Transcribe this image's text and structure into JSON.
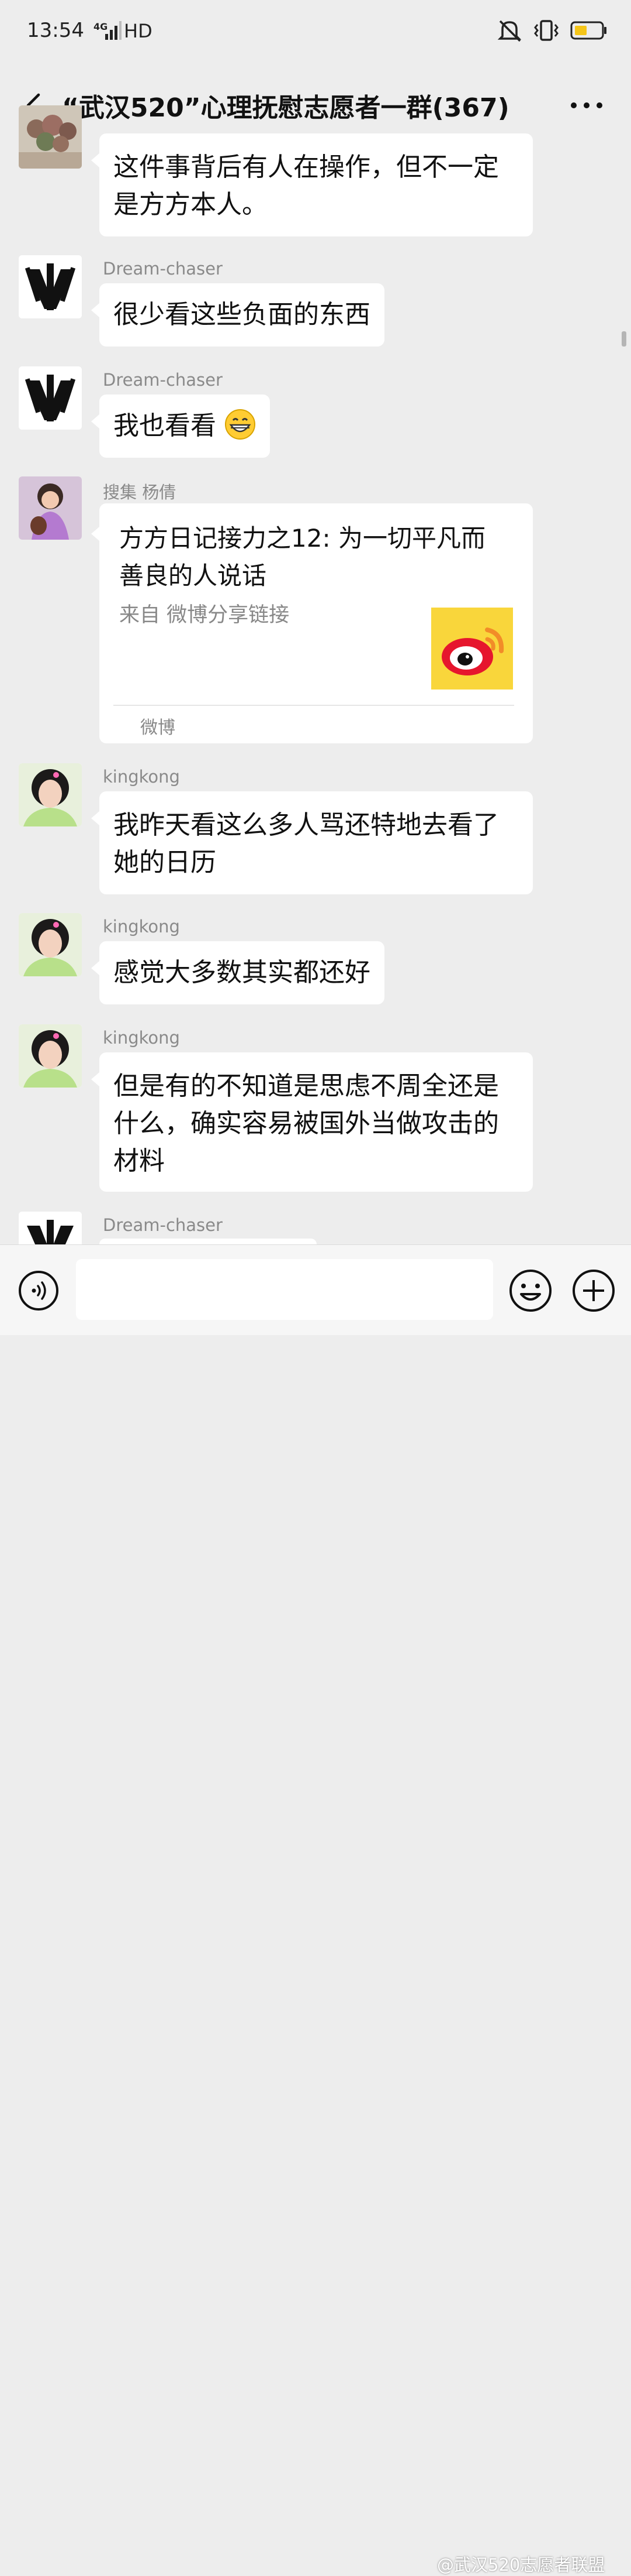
{
  "status_bar": {
    "time": "13:54",
    "network": "4G",
    "hd": "HD",
    "icons": [
      "mute-icon",
      "vibrate-icon",
      "battery-icon"
    ],
    "battery_color": "#f5c518"
  },
  "header": {
    "back_icon": "back-arrow-icon",
    "title": "“武汉520”心理抚慰志愿者一群(367)",
    "more_icon": "more-icon"
  },
  "messages": [
    {
      "sender": "",
      "text": "这件事背后有人在操作，但不一定是方方本人。"
    },
    {
      "sender": "Dream-chaser",
      "text": "很少看这些负面的东西"
    },
    {
      "sender": "Dream-chaser",
      "text": "我也看看",
      "emoji": "grinning-face-emoji"
    },
    {
      "sender": "搜集 杨倩",
      "card": {
        "title": "方方日记接力之12: 为一切平凡而善良的人说话",
        "source": "来自 微博分享链接",
        "thumb": "weibo-logo-icon",
        "app": "微博"
      }
    },
    {
      "sender": "kingkong",
      "text": "我昨天看这么多人骂还特地去看了她的日历"
    },
    {
      "sender": "kingkong",
      "text": "感觉大多数其实都还好"
    },
    {
      "sender": "kingkong",
      "text": "但是有的不知道是思虑不周全还是什么，确实容易被国外当做攻击的材料"
    },
    {
      "sender": "Dream-chaser",
      "text": ""
    }
  ],
  "input_bar": {
    "voice_icon": "voice-icon",
    "emoji_icon": "emoji-icon",
    "plus_icon": "plus-icon",
    "placeholder": ""
  },
  "watermark": "@武汉520志愿者联盟",
  "colors": {
    "background": "#ededed",
    "bubble": "#ffffff",
    "weibo_thumb": "#f9d63b",
    "weibo_red": "#e6162d"
  }
}
